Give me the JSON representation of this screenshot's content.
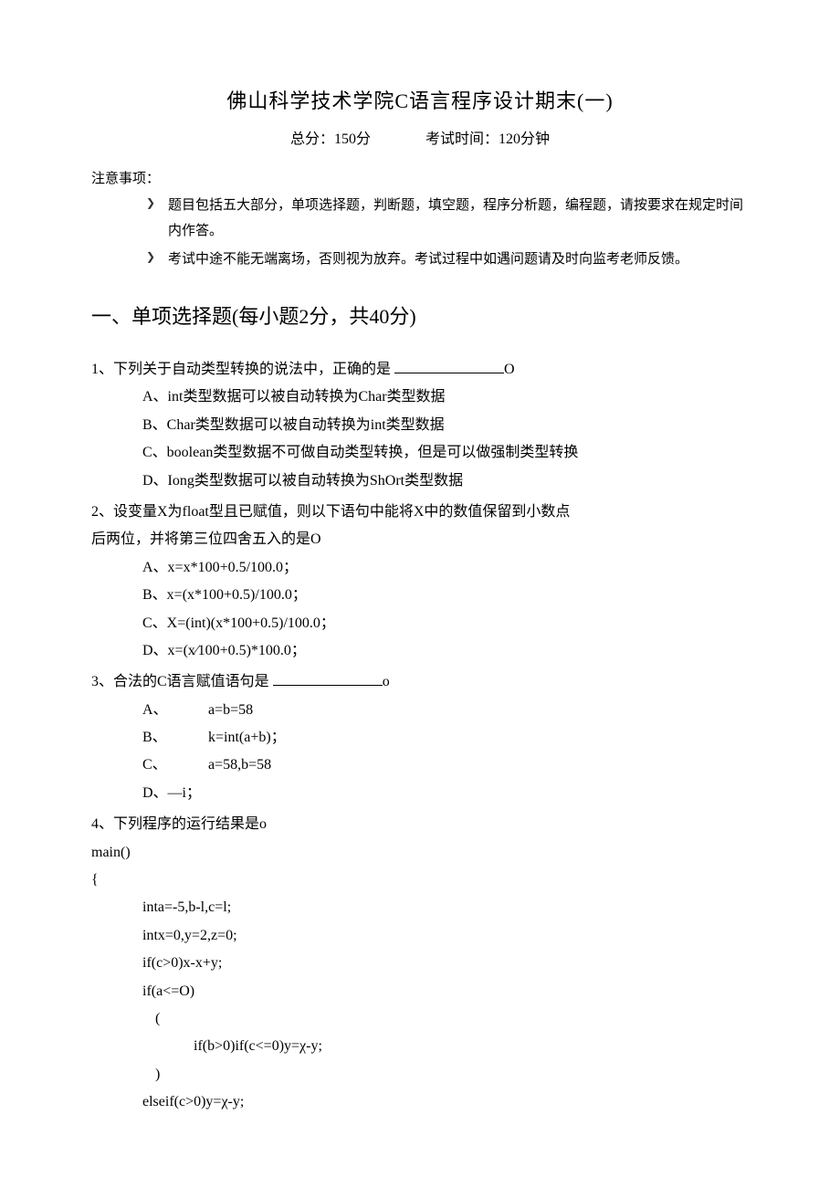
{
  "title": "佛山科学技术学院C语言程序设计期末(一)",
  "sub_score": "总分：150分",
  "sub_time": "考试时间：120分钟",
  "notes_label": "注意事项：",
  "notes": [
    "题目包括五大部分，单项选择题，判断题，填空题，程序分析题，编程题，请按要求在规定时间内作答。",
    "考试中途不能无端离场，否则视为放弃。考试过程中如遇问题请及时向监考老师反馈。"
  ],
  "section1_heading": "一、单项选择题(每小题2分，共40分)",
  "q1": {
    "stem_pre": "1、下列关于自动类型转换的说法中，正确的是 ",
    "stem_post": "O",
    "a": "A、int类型数据可以被自动转换为Char类型数据",
    "b": "B、Char类型数据可以被自动转换为int类型数据",
    "c": "C、boolean类型数据不可做自动类型转换，但是可以做强制类型转换",
    "d": "D、Iong类型数据可以被自动转换为ShOrt类型数据"
  },
  "q2": {
    "line1": "2、设变量X为float型且已赋值，则以下语句中能将X中的数值保留到小数点",
    "line2": "后两位，并将第三位四舍五入的是O",
    "a": "A、x=x*100+0.5/100.0；",
    "b": "B、x=(x*100+0.5)/100.0；",
    "c": "C、X=(int)(x*100+0.5)/100.0；",
    "d": "D、x=(x⁄100+0.5)*100.0；"
  },
  "q3": {
    "stem_pre": "3、合法的C语言赋值语句是 ",
    "stem_post": "o",
    "a_lbl": "A、",
    "a_val": "a=b=58",
    "b_lbl": "B、",
    "b_val": "k=int(a+b)；",
    "c_lbl": "C、",
    "c_val": "a=58,b=58",
    "d": "D、—i；"
  },
  "q4": {
    "stem": "4、下列程序的运行结果是o",
    "code": [
      "main()",
      "{",
      "inta=-5,b-l,c=l;",
      "intx=0,y=2,z=0;",
      "if(c>0)x-x+y;",
      "if(a<=O)",
      "(",
      "if(b>0)if(c<=0)y=χ-y;",
      ")",
      "elseif(c>0)y=χ-y;"
    ]
  }
}
